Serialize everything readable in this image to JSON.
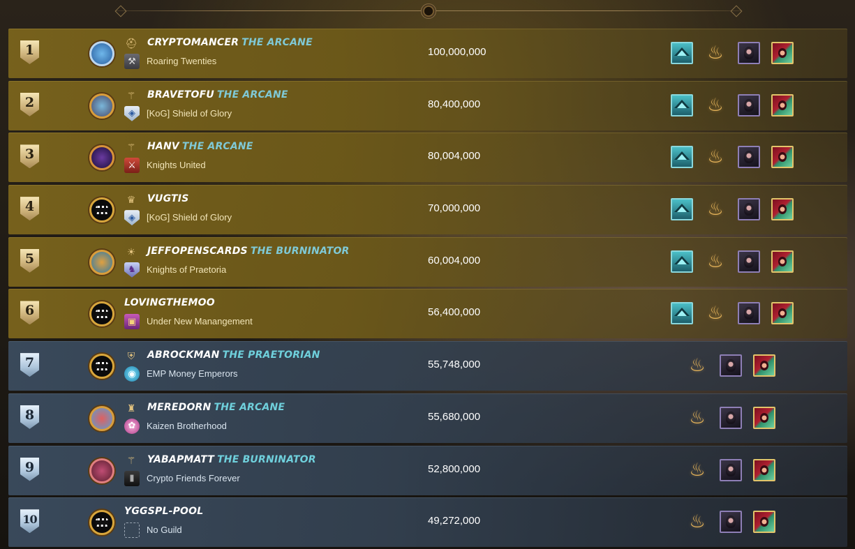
{
  "leaderboard": {
    "rows": [
      {
        "rank": "1",
        "tier": "gold",
        "name": "CRYPTOMANCER",
        "title": "THE ARCANE",
        "guild": "Roaring Twenties",
        "score": "100,000,000",
        "avatar": "a-1",
        "emblem": "helmet-icon",
        "guild_icon": "gi-axe",
        "rewards": [
          "chest-icon",
          "flame-icon",
          "dark-card-icon",
          "red-card-icon"
        ]
      },
      {
        "rank": "2",
        "tier": "gold",
        "name": "BRAVETOFU",
        "title": "THE ARCANE",
        "guild": "[KoG] Shield of Glory",
        "score": "80,400,000",
        "avatar": "a-2",
        "emblem": "staff-icon",
        "guild_icon": "gi-shield",
        "rewards": [
          "chest-icon",
          "flame-icon",
          "dark-card-icon",
          "red-card-icon"
        ]
      },
      {
        "rank": "3",
        "tier": "gold",
        "name": "HANV",
        "title": "THE ARCANE",
        "guild": "Knights United",
        "score": "80,004,000",
        "avatar": "a-3",
        "emblem": "staff-icon",
        "guild_icon": "gi-knight",
        "rewards": [
          "chest-icon",
          "flame-icon",
          "dark-card-icon",
          "red-card-icon"
        ]
      },
      {
        "rank": "4",
        "tier": "gold",
        "name": "VUGTIS",
        "title": "",
        "guild": "[KoG] Shield of Glory",
        "score": "70,000,000",
        "avatar": "a-mono",
        "emblem": "crown-icon",
        "guild_icon": "gi-shield",
        "rewards": [
          "chest-icon",
          "flame-icon",
          "dark-card-icon",
          "red-card-icon"
        ]
      },
      {
        "rank": "5",
        "tier": "gold",
        "name": "JEFFOPENSCARDS",
        "title": "THE BURNINATOR",
        "guild": "Knights of Praetoria",
        "score": "60,004,000",
        "avatar": "a-5",
        "emblem": "sun-icon",
        "guild_icon": "gi-praetoria",
        "rewards": [
          "chest-icon",
          "flame-icon",
          "dark-card-icon",
          "red-card-icon"
        ]
      },
      {
        "rank": "6",
        "tier": "gold",
        "name": "LOVINGTHEMOO",
        "title": "",
        "guild": "Under New Manangement",
        "score": "56,400,000",
        "avatar": "a-mono",
        "emblem": "",
        "guild_icon": "gi-unm",
        "rewards": [
          "chest-icon",
          "flame-icon",
          "dark-card-icon",
          "red-card-icon"
        ]
      },
      {
        "rank": "7",
        "tier": "silver",
        "name": "ABROCKMAN",
        "title": "THE PRAETORIAN",
        "guild": "EMP Money Emperors",
        "score": "55,748,000",
        "avatar": "a-mono",
        "emblem": "shield-emblem-icon",
        "guild_icon": "gi-emp",
        "rewards": [
          "flame-icon",
          "dark-card-icon",
          "red-card-icon"
        ]
      },
      {
        "rank": "8",
        "tier": "silver",
        "name": "MEREDORN",
        "title": "THE ARCANE",
        "guild": "Kaizen Brotherhood",
        "score": "55,680,000",
        "avatar": "a-8",
        "emblem": "tower-icon",
        "guild_icon": "gi-kaizen",
        "rewards": [
          "flame-icon",
          "dark-card-icon",
          "red-card-icon"
        ]
      },
      {
        "rank": "9",
        "tier": "silver",
        "name": "YABAPMATT",
        "title": "THE BURNINATOR",
        "guild": "Crypto Friends Forever",
        "score": "52,800,000",
        "avatar": "a-9",
        "emblem": "staff-icon",
        "guild_icon": "gi-cff",
        "rewards": [
          "flame-icon",
          "dark-card-icon",
          "red-card-icon"
        ]
      },
      {
        "rank": "10",
        "tier": "silver",
        "name": "YGGSPL-POOL",
        "title": "",
        "guild": "No Guild",
        "score": "49,272,000",
        "avatar": "a-mono",
        "emblem": "",
        "guild_icon": "gi-none",
        "rewards": [
          "flame-icon",
          "dark-card-icon",
          "red-card-icon"
        ]
      }
    ]
  },
  "colors": {
    "gold_row": "#78621c",
    "silver_row": "#3a4a5c",
    "title_accent": "#6fd0dc",
    "guild_text": "#f2e5b8"
  }
}
